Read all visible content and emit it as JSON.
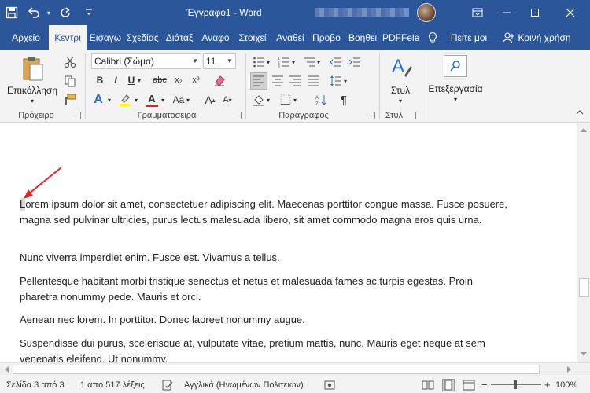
{
  "window": {
    "title": "Έγγραφο1 - Word"
  },
  "tabs": [
    {
      "label": "Αρχείο"
    },
    {
      "label": "Κεντρι"
    },
    {
      "label": "Εισαγω"
    },
    {
      "label": "Σχεδίας"
    },
    {
      "label": "Διάταξ"
    },
    {
      "label": "Αναφο"
    },
    {
      "label": "Στοιχεί"
    },
    {
      "label": "Αναθεί"
    },
    {
      "label": "Προβο"
    },
    {
      "label": "Βοήθει"
    },
    {
      "label": "PDFFelei"
    },
    {
      "label": "Πείτε μοι"
    },
    {
      "label": "Κοινή χρήση"
    }
  ],
  "ribbon": {
    "clipboard": {
      "paste_label": "Επικόλληση",
      "group_label": "Πρόχειρο"
    },
    "font": {
      "font_name": "Calibri (Σώμα)",
      "font_size": "11",
      "bold": "B",
      "italic": "I",
      "underline": "U",
      "strike": "abc",
      "subscript": "x₂",
      "superscript": "x²",
      "font_effects": "A",
      "font_color": "A",
      "change_case": "Aa",
      "grow": "A",
      "shrink": "A",
      "group_label": "Γραμματοσειρά"
    },
    "paragraph": {
      "pilcrow": "¶",
      "group_label": "Παράγραφος"
    },
    "styles": {
      "styles_label": "Στυλ",
      "group_label": "Στυλ"
    },
    "editing": {
      "editing_label": "Επεξεργασία"
    }
  },
  "document": {
    "paragraphs": [
      "Lorem ipsum dolor sit amet, consectetuer adipiscing elit. Maecenas porttitor congue massa. Fusce posuere, magna sed pulvinar ultricies, purus lectus malesuada libero, sit amet commodo magna eros quis urna.",
      "Nunc viverra imperdiet enim. Fusce est. Vivamus a tellus.",
      "Pellentesque habitant morbi tristique senectus et netus et malesuada fames ac turpis egestas. Proin pharetra nonummy pede. Mauris et orci.",
      "Aenean nec lorem. In porttitor. Donec laoreet nonummy augue.",
      "Suspendisse dui purus, scelerisque at, vulputate vitae, pretium mattis, nunc. Mauris eget neque at sem venenatis eleifend. Ut nonummy."
    ]
  },
  "status": {
    "page": "Σελίδα 3 από 3",
    "words": "1 από 517 λέξεις",
    "language": "Αγγλικά (Ηνωμένων Πολιτειών)",
    "zoom": "100%",
    "zoom_minus": "−",
    "zoom_plus": "+"
  },
  "colors": {
    "accent": "#2b579a",
    "highlight": "#ffff00",
    "font_red": "#e02020",
    "arrow": "#e8221e"
  }
}
